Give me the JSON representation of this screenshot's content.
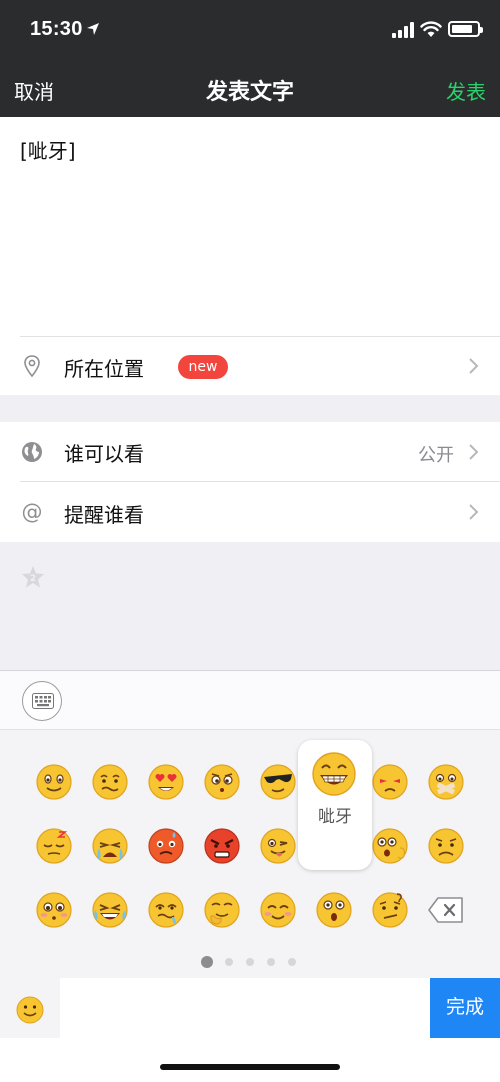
{
  "status_bar": {
    "time": "15:30"
  },
  "nav": {
    "cancel_label": "取消",
    "title": "发表文字",
    "publish_label": "发表"
  },
  "compose": {
    "text": "[呲牙]"
  },
  "location": {
    "label": "所在位置",
    "badge": "new"
  },
  "visibility": {
    "label": "谁可以看",
    "value": "公开"
  },
  "mention": {
    "label": "提醒谁看"
  },
  "emoji_preview": {
    "caption": "呲牙"
  },
  "pager": {
    "page_count": 5,
    "active_page": 1
  },
  "bottom": {
    "done_label": "完成"
  },
  "colors": {
    "publish_green": "#29d36b",
    "badge_red": "#f2453d",
    "done_blue": "#1e86f5"
  }
}
